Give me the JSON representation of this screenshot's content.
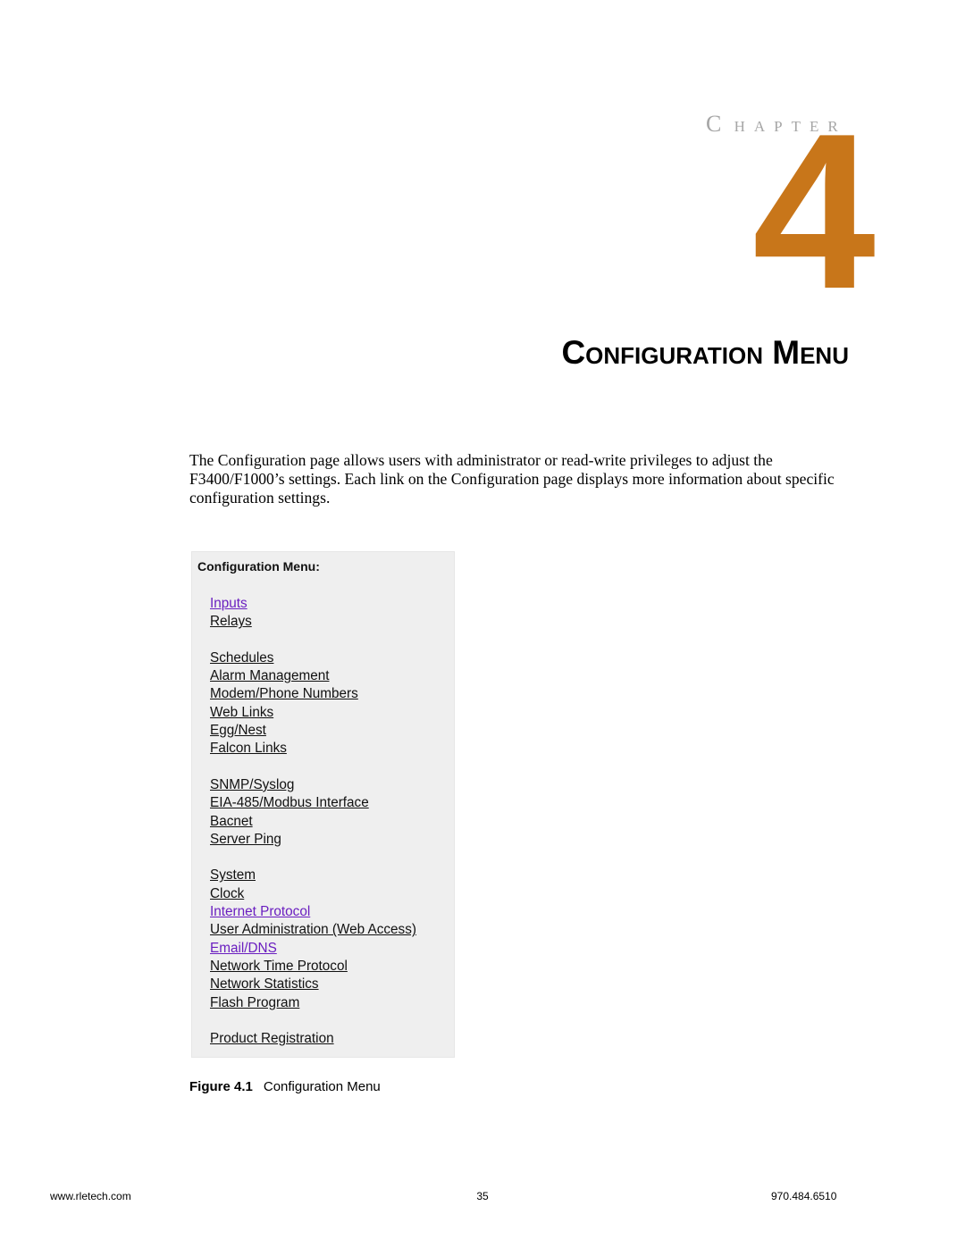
{
  "chapter": {
    "label": "Chapter",
    "number": "4",
    "title": "Configuration Menu",
    "number_color": "#c8761a",
    "label_color": "#a6a6a6"
  },
  "intro_text": "The Configuration page allows users with administrator or read-write privileges to adjust the F3400/F1000’s settings. Each link on the Configuration page displays more information about specific configuration settings.",
  "figure": {
    "panel_title": "Configuration Menu:",
    "link_color_visited": "#6a1ec0",
    "groups": [
      [
        {
          "label": "Inputs",
          "visited": true
        },
        {
          "label": "Relays",
          "visited": false
        }
      ],
      [
        {
          "label": "Schedules",
          "visited": false
        },
        {
          "label": "Alarm Management",
          "visited": false
        },
        {
          "label": "Modem/Phone Numbers",
          "visited": false
        },
        {
          "label": "Web Links",
          "visited": false
        },
        {
          "label": "Egg/Nest",
          "visited": false
        },
        {
          "label": "Falcon Links",
          "visited": false
        }
      ],
      [
        {
          "label": "SNMP/Syslog",
          "visited": false
        },
        {
          "label": "EIA-485/Modbus Interface",
          "visited": false
        },
        {
          "label": "Bacnet",
          "visited": false
        },
        {
          "label": "Server Ping",
          "visited": false
        }
      ],
      [
        {
          "label": "System",
          "visited": false
        },
        {
          "label": "Clock",
          "visited": false
        },
        {
          "label": "Internet Protocol",
          "visited": true
        },
        {
          "label": "User Administration (Web Access)",
          "visited": false
        },
        {
          "label": "Email/DNS",
          "visited": true
        },
        {
          "label": "Network Time Protocol",
          "visited": false
        },
        {
          "label": "Network Statistics",
          "visited": false
        },
        {
          "label": "Flash Program",
          "visited": false
        }
      ],
      [
        {
          "label": "Product Registration",
          "visited": false
        }
      ]
    ],
    "caption_number": "Figure 4.1",
    "caption_text": "Configuration Menu"
  },
  "footer": {
    "website": "www.rletech.com",
    "page_number": "35",
    "phone": "970.484.6510"
  }
}
